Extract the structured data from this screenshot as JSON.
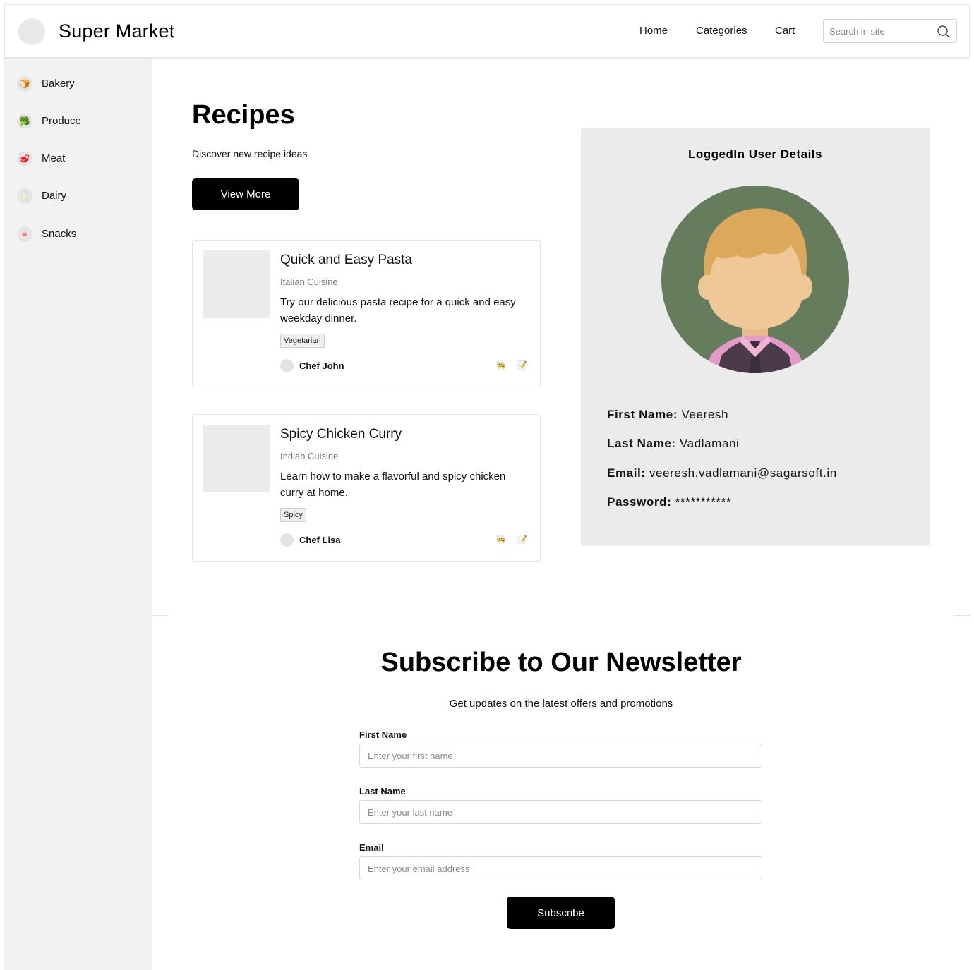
{
  "header": {
    "brand": "Super Market",
    "nav": [
      "Home",
      "Categories",
      "Cart"
    ],
    "search_placeholder": "Search in site"
  },
  "sidebar": {
    "items": [
      {
        "label": "Bakery",
        "icon": "bread-icon",
        "glyph": "🍞"
      },
      {
        "label": "Produce",
        "icon": "broccoli-icon",
        "glyph": "🥦"
      },
      {
        "label": "Meat",
        "icon": "meat-icon",
        "glyph": "🥩"
      },
      {
        "label": "Dairy",
        "icon": "milk-icon",
        "glyph": "🥛"
      },
      {
        "label": "Snacks",
        "icon": "candy-icon",
        "glyph": "🍬"
      }
    ]
  },
  "main": {
    "title": "Recipes",
    "subtitle": "Discover new recipe ideas",
    "view_more": "View More",
    "recipes": [
      {
        "title": "Quick and Easy Pasta",
        "cuisine": "Italian Cuisine",
        "description": "Try our delicious pasta recipe for a quick and easy weekday dinner.",
        "tag": "Vegetarian",
        "author": "Chef John"
      },
      {
        "title": "Spicy Chicken Curry",
        "cuisine": "Indian Cuisine",
        "description": "Learn how to make a flavorful and spicy chicken curry at home.",
        "tag": "Spicy",
        "author": "Chef Lisa"
      }
    ],
    "card_icons": {
      "chef": "🧑‍🍳",
      "memo": "📝"
    }
  },
  "user": {
    "title": "LoggedIn User Details",
    "first_name_label": "First Name:",
    "first_name": "Veeresh",
    "last_name_label": "Last Name:",
    "last_name": "Vadlamani",
    "email_label": "Email:",
    "email": "veeresh.vadlamani@sagarsoft.in",
    "password_label": "Password:",
    "password": "***********"
  },
  "newsletter": {
    "title": "Subscribe to Our Newsletter",
    "subtitle": "Get updates on the latest offers and promotions",
    "first_name_label": "First Name",
    "first_name_placeholder": "Enter your first name",
    "last_name_label": "Last Name",
    "last_name_placeholder": "Enter your last name",
    "email_label": "Email",
    "email_placeholder": "Enter your email address",
    "subscribe": "Subscribe"
  },
  "colors": {
    "accent": "#000000",
    "sidebar_bg": "#f2f2f2",
    "panel_bg": "#ebebeb",
    "avatar_bg": "#657d5c"
  }
}
